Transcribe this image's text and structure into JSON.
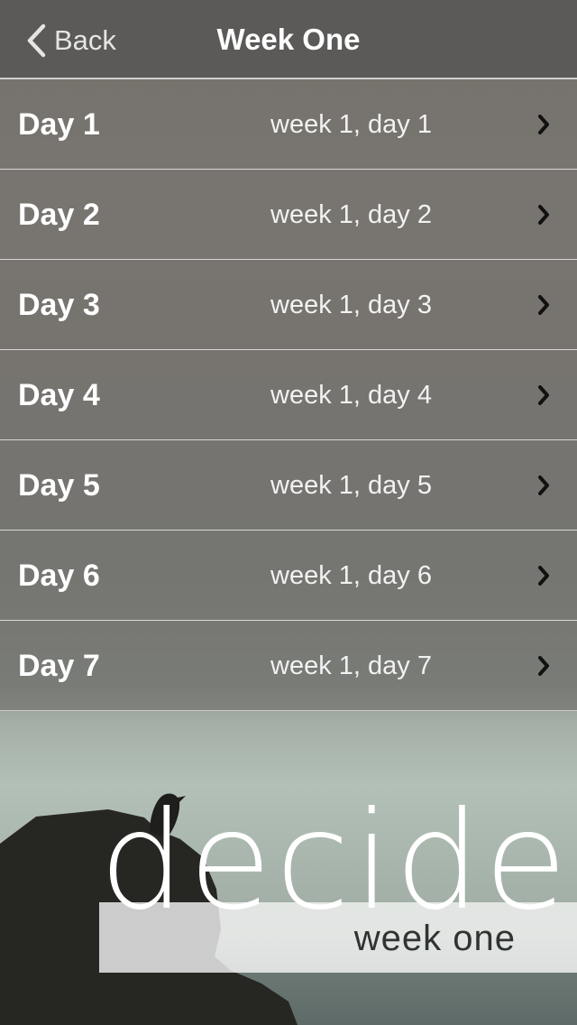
{
  "header": {
    "back_label": "Back",
    "title": "Week One"
  },
  "days": [
    {
      "label": "Day 1",
      "subtitle": "week 1, day 1"
    },
    {
      "label": "Day 2",
      "subtitle": "week 1, day 2"
    },
    {
      "label": "Day 3",
      "subtitle": "week 1, day 3"
    },
    {
      "label": "Day 4",
      "subtitle": "week 1, day 4"
    },
    {
      "label": "Day 5",
      "subtitle": "week 1, day 5"
    },
    {
      "label": "Day 6",
      "subtitle": "week 1, day 6"
    },
    {
      "label": "Day 7",
      "subtitle": "week 1, day 7"
    }
  ],
  "branding": {
    "word": "decide",
    "subtitle": "week one"
  },
  "icons": {
    "back": "chevron-left-icon",
    "row": "chevron-right-icon"
  },
  "colors": {
    "header_bg": "#5b5a58",
    "row_text": "#ffffff",
    "chevron": "#111111"
  }
}
